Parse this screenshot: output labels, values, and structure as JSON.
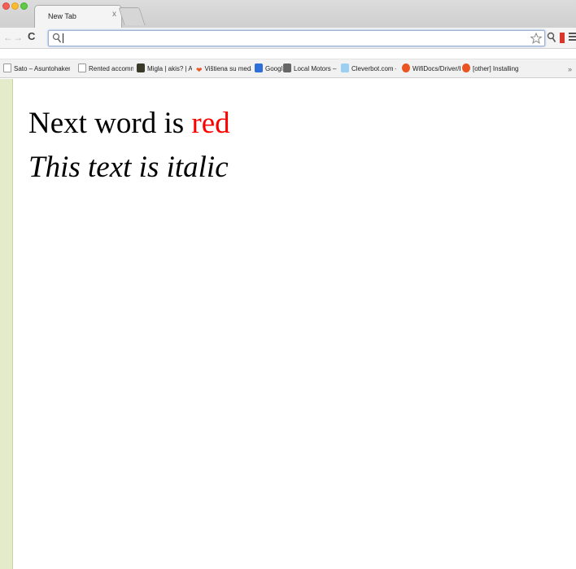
{
  "window": {
    "tab_title": "New Tab",
    "tab_close": "x"
  },
  "toolbar": {
    "back_glyph": "←",
    "forward_glyph": "→",
    "reload_glyph": "C",
    "omnibox_value": ""
  },
  "bookmarks": [
    {
      "label": "Sato – Asuntohakem",
      "icon": "page-icon"
    },
    {
      "label": "Rented accommodat",
      "icon": "page-icon"
    },
    {
      "label": "Migla | akis? | AšVyr",
      "icon": "site-icon"
    },
    {
      "label": "Vištiena su medaus",
      "icon": "heart-icon"
    },
    {
      "label": "Google",
      "icon": "google-icon"
    },
    {
      "label": "Local Motors – Emp",
      "icon": "site-icon"
    },
    {
      "label": "Cleverbot.com – a c",
      "icon": "cleverbot-icon"
    },
    {
      "label": "WifiDocs/Driver/bcn",
      "icon": "ubuntu-icon"
    },
    {
      "label": "[other] Installing firm",
      "icon": "ubuntu-icon"
    }
  ],
  "bookmarks_overflow": "»",
  "page": {
    "line1_prefix": "Next word is ",
    "line1_red_word": "red",
    "line2": "This text is italic",
    "red_color": "#ff0000"
  }
}
